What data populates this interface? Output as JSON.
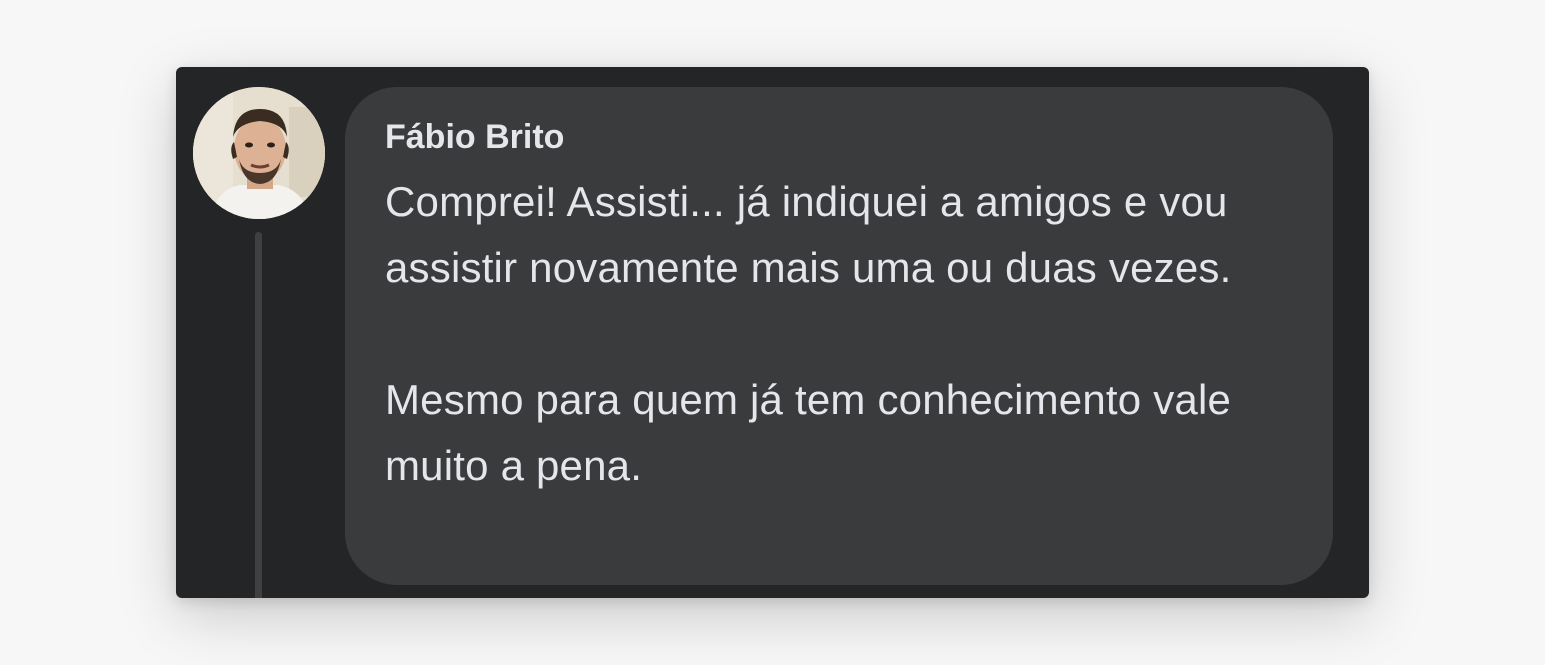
{
  "comment": {
    "author": "Fábio Brito",
    "paragraphs": [
      "Comprei! Assisti... já indiquei a amigos e vou assistir novamente mais uma ou duas vezes.",
      "Mesmo para quem já tem conhecimento vale muito a pena."
    ],
    "avatar_icon": "profile-photo"
  },
  "colors": {
    "page_background": "#f7f7f7",
    "card_background": "#242526",
    "bubble_background": "#3a3b3c",
    "text": "#e4e6eb",
    "thread_line": "#3e4042"
  }
}
